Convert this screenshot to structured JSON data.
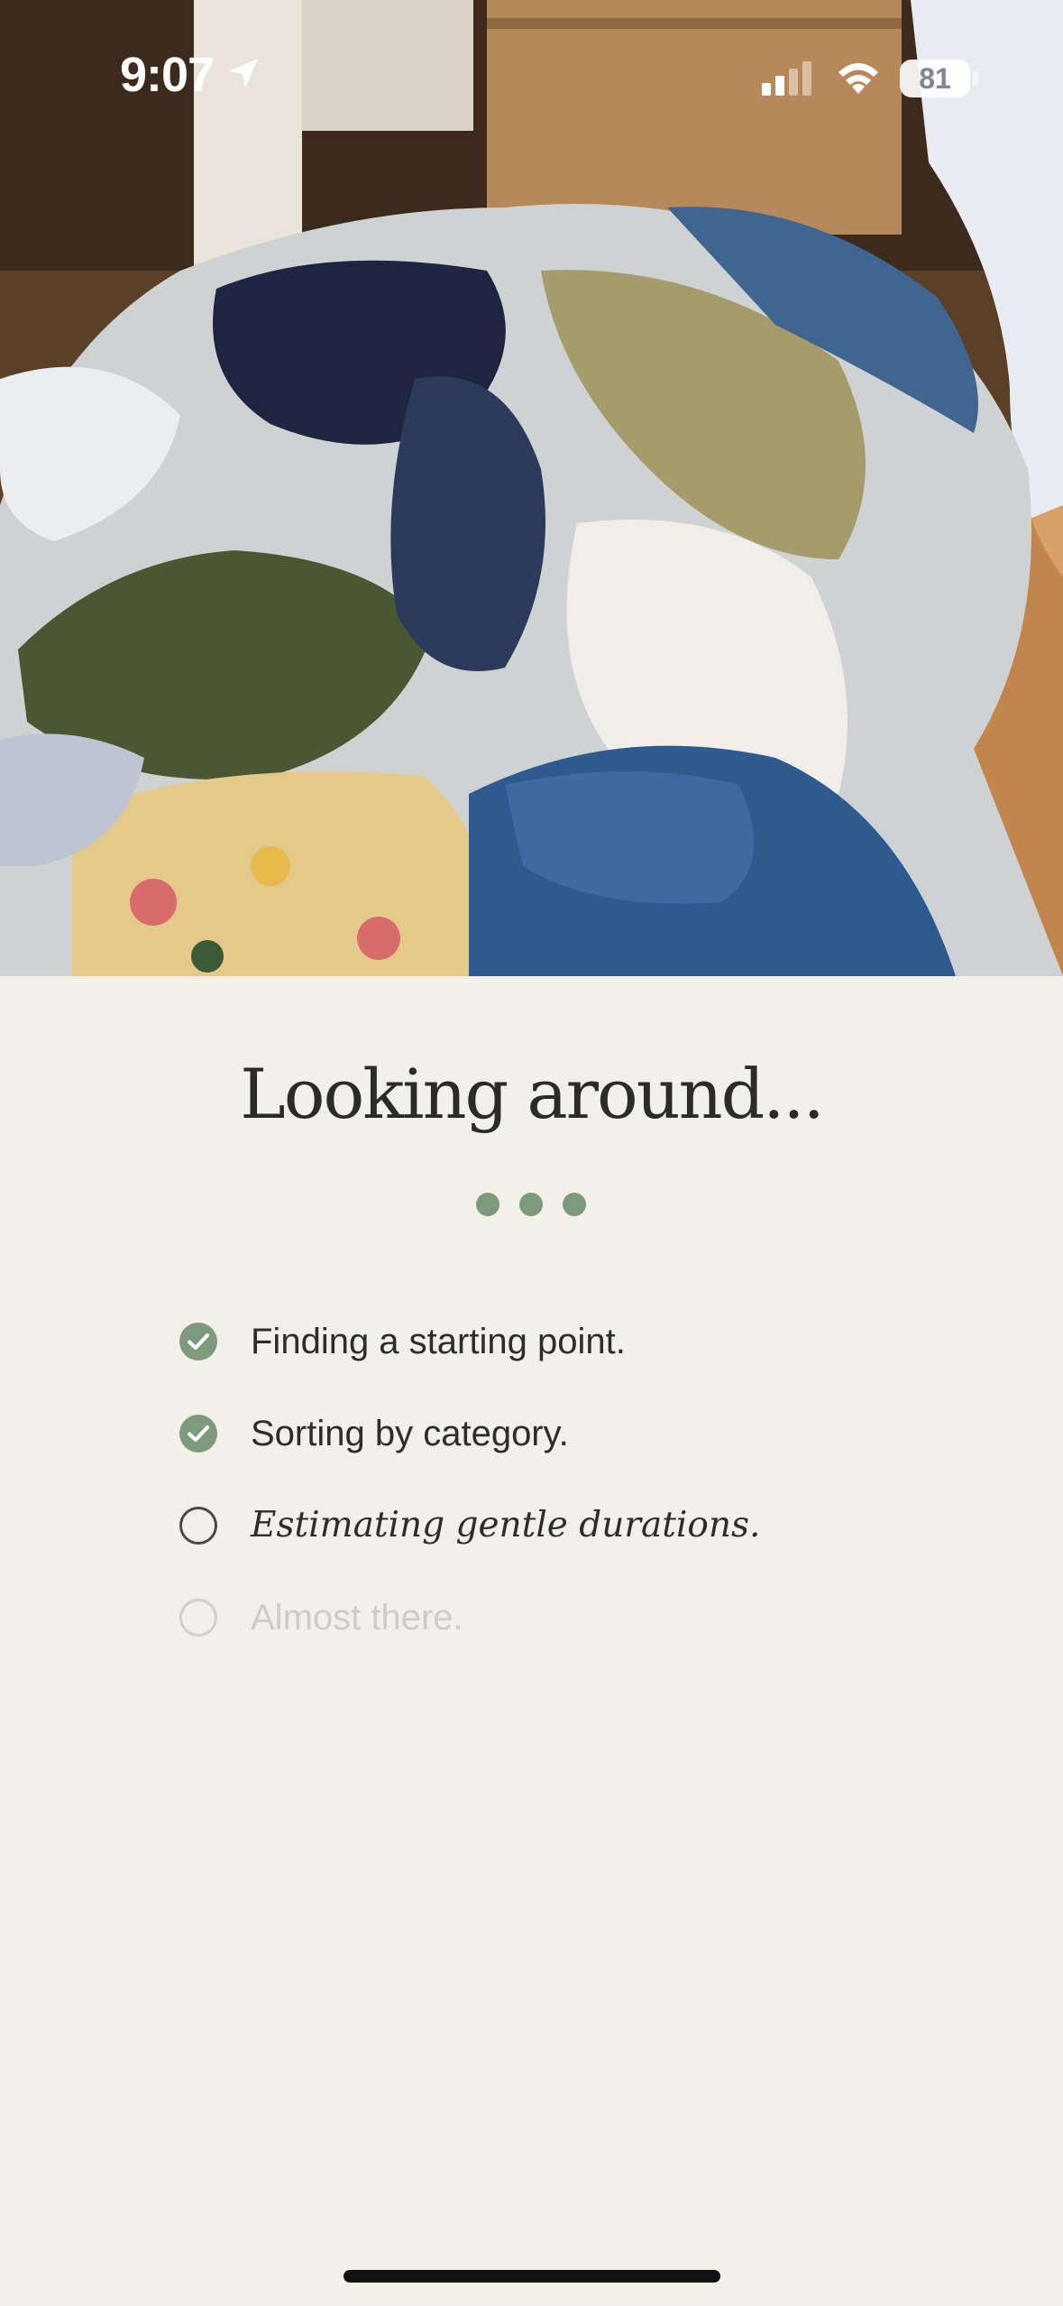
{
  "status_bar": {
    "time": "9:07",
    "battery": "81",
    "icons": [
      "location-arrow-icon",
      "cellular-signal-icon",
      "wifi-icon",
      "battery-icon"
    ]
  },
  "hero_image": {
    "description_icon": "photo-pile-of-clothes"
  },
  "main": {
    "title": "Looking around...",
    "progress_dots": 3,
    "steps": [
      {
        "label": "Finding a starting point.",
        "state": "done"
      },
      {
        "label": "Sorting by category.",
        "state": "done"
      },
      {
        "label": "Estimating gentle durations.",
        "state": "current"
      },
      {
        "label": "Almost there.",
        "state": "pending"
      }
    ]
  },
  "colors": {
    "background": "#f3f0ea",
    "accent": "#7d9a7c",
    "text": "#2b2b28",
    "muted": "#cfccc6"
  }
}
